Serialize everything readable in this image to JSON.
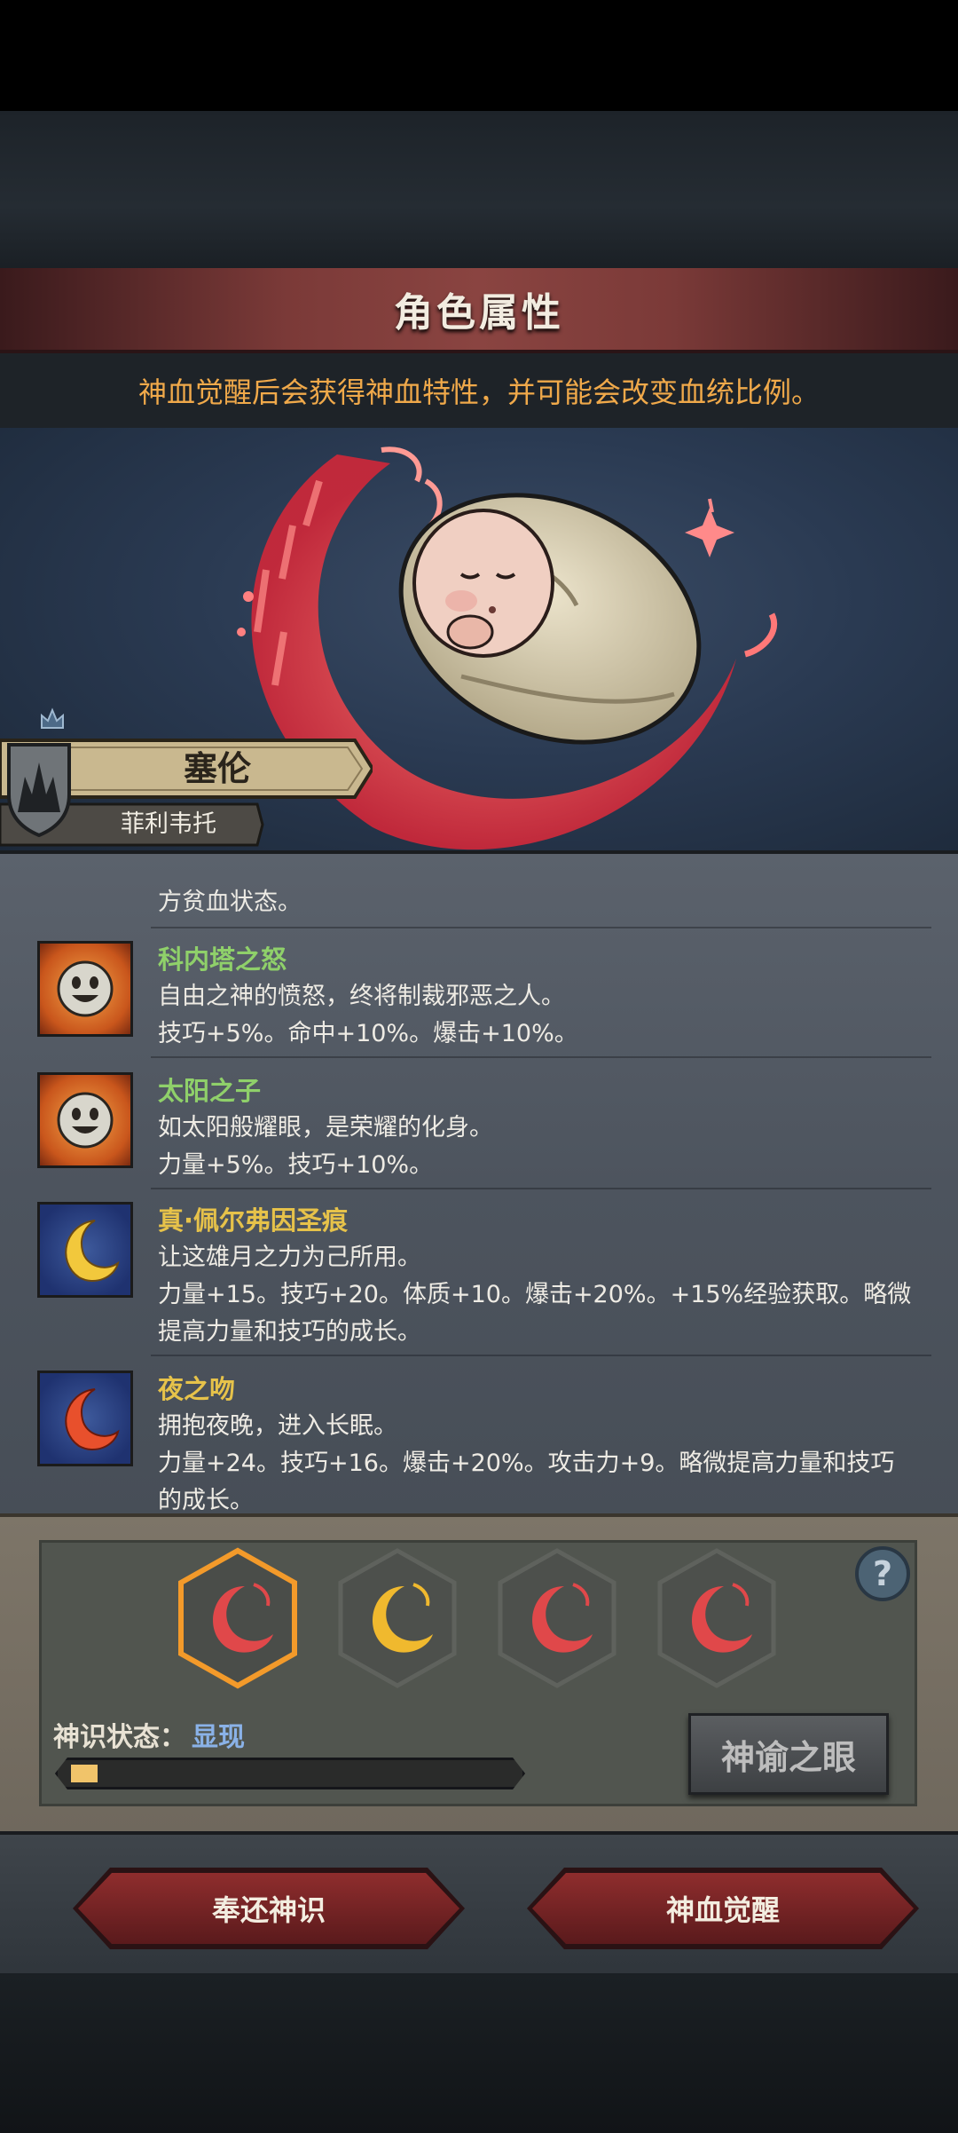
{
  "header": {
    "title": "角色属性",
    "subtitle": "神血觉醒后会获得神血特性，并可能会改变血统比例。"
  },
  "character": {
    "name": "塞伦",
    "title": "菲利韦托"
  },
  "traits": {
    "partial_top": "方贫血状态。",
    "items": [
      {
        "name": "科内塔之怒",
        "name_color": "#8fd06a",
        "icon": "sun-face-icon",
        "lines": [
          "自由之神的愤怒，终将制裁邪恶之人。",
          "技巧+5%。命中+10%。爆击+10%。"
        ]
      },
      {
        "name": "太阳之子",
        "name_color": "#8fd06a",
        "icon": "sun-face-icon",
        "lines": [
          "如太阳般耀眼，是荣耀的化身。",
          "力量+5%。技巧+10%。"
        ]
      },
      {
        "name": "真·佩尔弗因圣痕",
        "name_color": "#e6c24a",
        "icon": "golden-moon-icon",
        "lines": [
          "让这雄月之力为己所用。",
          "力量+15。技巧+20。体质+10。爆击+20%。+15%经验获取。略微",
          "提高力量和技巧的成长。"
        ]
      },
      {
        "name": "夜之吻",
        "name_color": "#e6c24a",
        "icon": "red-moon-icon",
        "lines": [
          "拥抱夜晚，进入长眠。",
          "力量+24。技巧+16。爆击+20%。攻击力+9。略微提高力量和技巧",
          "的成长。"
        ]
      }
    ]
  },
  "slots": [
    {
      "icon": "red-crescent-icon",
      "color": "#e0484a",
      "selected": true
    },
    {
      "icon": "gold-crescent-icon",
      "color": "#f0b92e",
      "selected": false
    },
    {
      "icon": "red-crescent-icon",
      "color": "#e0484a",
      "selected": false
    },
    {
      "icon": "red-crescent-icon",
      "color": "#e0484a",
      "selected": false
    }
  ],
  "status": {
    "label": "神识状态：",
    "value": "显现",
    "progress": 0.06
  },
  "buttons": {
    "help": "?",
    "oracle": "神谕之眼",
    "return": "奉还神识",
    "awaken": "神血觉醒"
  }
}
